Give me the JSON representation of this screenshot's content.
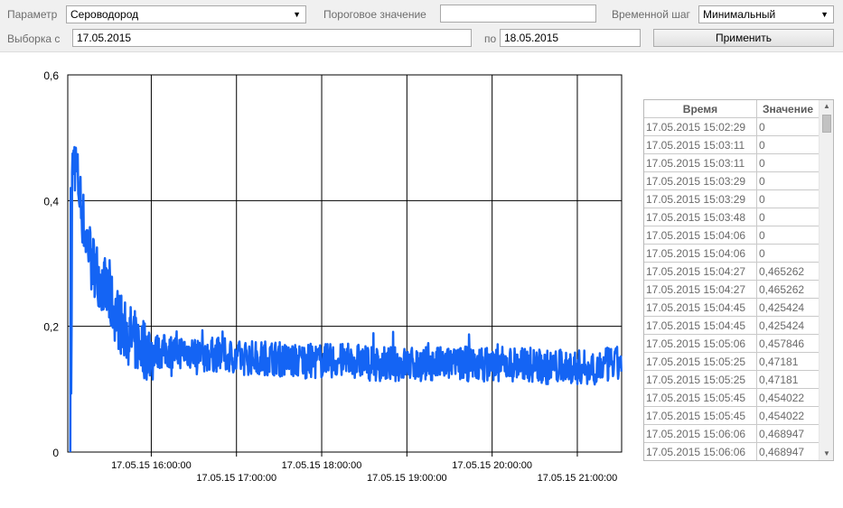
{
  "toolbar": {
    "param_label": "Параметр",
    "param_value": "Сероводород",
    "threshold_label": "Пороговое значение",
    "threshold_value": "",
    "timestep_label": "Временной шаг",
    "timestep_value": "Минимальный",
    "from_label": "Выборка с",
    "from_value": "17.05.2015",
    "to_label": "по",
    "to_value": "18.05.2015",
    "apply_label": "Применить",
    "dropdown_icon": "▼"
  },
  "chart_data": {
    "type": "line",
    "title": "",
    "xlabel": "",
    "ylabel": "",
    "ylim": [
      0,
      0.6
    ],
    "xlim": [
      "17.05.15 15:02",
      "17.05.15 21:32"
    ],
    "y_ticks": [
      "0",
      "0,2",
      "0,4",
      "0,6"
    ],
    "x_ticks": [
      "17.05.15 16:00:00",
      "17.05.15 17:00:00",
      "17.05.15 18:00:00",
      "17.05.15 19:00:00",
      "17.05.15 20:00:00",
      "17.05.15 21:00:00"
    ],
    "grid": true,
    "line_color": "#1464f4",
    "series": [
      {
        "values_note_points_per_hour": 6,
        "x_hours_after_15": [
          0.04,
          0.05,
          0.07,
          0.1,
          0.15,
          0.2,
          0.3,
          0.4,
          0.5,
          0.6,
          0.7,
          0.8,
          0.9,
          1.0,
          1.2,
          1.4,
          1.6,
          1.8,
          2.0,
          2.2,
          2.4,
          2.6,
          2.8,
          3.0,
          3.2,
          3.4,
          3.6,
          3.8,
          4.0,
          4.2,
          4.4,
          4.6,
          4.8,
          5.0,
          5.2,
          5.4,
          5.6,
          5.8,
          6.0,
          6.2,
          6.4,
          6.5
        ],
        "y": [
          0,
          0.44,
          0.47,
          0.45,
          0.4,
          0.35,
          0.3,
          0.27,
          0.24,
          0.21,
          0.19,
          0.175,
          0.165,
          0.16,
          0.16,
          0.16,
          0.155,
          0.155,
          0.15,
          0.15,
          0.15,
          0.145,
          0.145,
          0.145,
          0.145,
          0.145,
          0.14,
          0.14,
          0.14,
          0.14,
          0.14,
          0.14,
          0.14,
          0.14,
          0.14,
          0.14,
          0.135,
          0.135,
          0.135,
          0.135,
          0.14,
          0.14
        ]
      }
    ]
  },
  "table": {
    "headers": [
      "Время",
      "Значение"
    ],
    "rows": [
      [
        "17.05.2015 15:02:29",
        "0"
      ],
      [
        "17.05.2015 15:03:11",
        "0"
      ],
      [
        "17.05.2015 15:03:11",
        "0"
      ],
      [
        "17.05.2015 15:03:29",
        "0"
      ],
      [
        "17.05.2015 15:03:29",
        "0"
      ],
      [
        "17.05.2015 15:03:48",
        "0"
      ],
      [
        "17.05.2015 15:04:06",
        "0"
      ],
      [
        "17.05.2015 15:04:06",
        "0"
      ],
      [
        "17.05.2015 15:04:27",
        "0,465262"
      ],
      [
        "17.05.2015 15:04:27",
        "0,465262"
      ],
      [
        "17.05.2015 15:04:45",
        "0,425424"
      ],
      [
        "17.05.2015 15:04:45",
        "0,425424"
      ],
      [
        "17.05.2015 15:05:06",
        "0,457846"
      ],
      [
        "17.05.2015 15:05:25",
        "0,47181"
      ],
      [
        "17.05.2015 15:05:25",
        "0,47181"
      ],
      [
        "17.05.2015 15:05:45",
        "0,454022"
      ],
      [
        "17.05.2015 15:05:45",
        "0,454022"
      ],
      [
        "17.05.2015 15:06:06",
        "0,468947"
      ],
      [
        "17.05.2015 15:06:06",
        "0,468947"
      ]
    ],
    "scroll_up_icon": "▲",
    "scroll_down_icon": "▼"
  }
}
